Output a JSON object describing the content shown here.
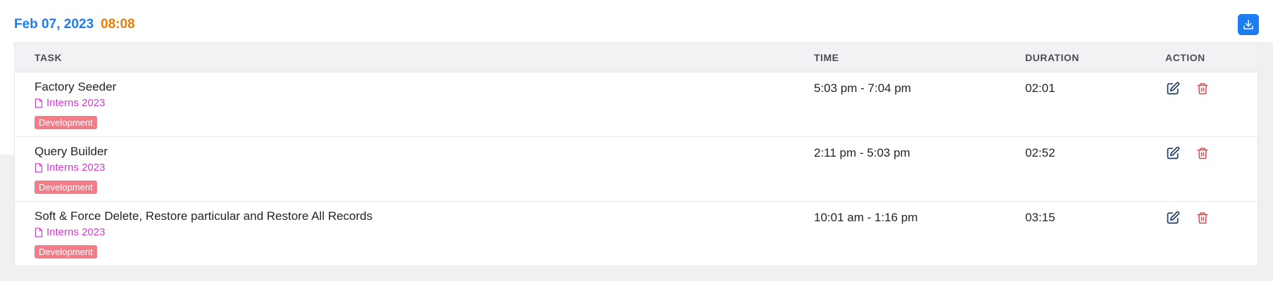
{
  "header": {
    "date": "Feb 07, 2023",
    "total": "08:08",
    "download_icon": "download-icon"
  },
  "table": {
    "columns": [
      "TASK",
      "TIME",
      "DURATION",
      "ACTION"
    ],
    "rows": [
      {
        "task": "Factory Seeder",
        "project": "Interns 2023",
        "tag": "Development",
        "time": "5:03 pm - 7:04 pm",
        "duration": "02:01"
      },
      {
        "task": "Query Builder",
        "project": "Interns 2023",
        "tag": "Development",
        "time": "2:11 pm - 5:03 pm",
        "duration": "02:52"
      },
      {
        "task": "Soft & Force Delete, Restore particular and Restore All Records",
        "project": "Interns 2023",
        "tag": "Development",
        "time": "10:01 am - 1:16 pm",
        "duration": "03:15"
      }
    ]
  },
  "colors": {
    "date": "#1e7cf0",
    "total": "#e67e0b",
    "project": "#d63ad6",
    "tag_bg": "#f47c88",
    "edit_icon": "#1f3a5f",
    "delete_icon": "#e0424d"
  }
}
